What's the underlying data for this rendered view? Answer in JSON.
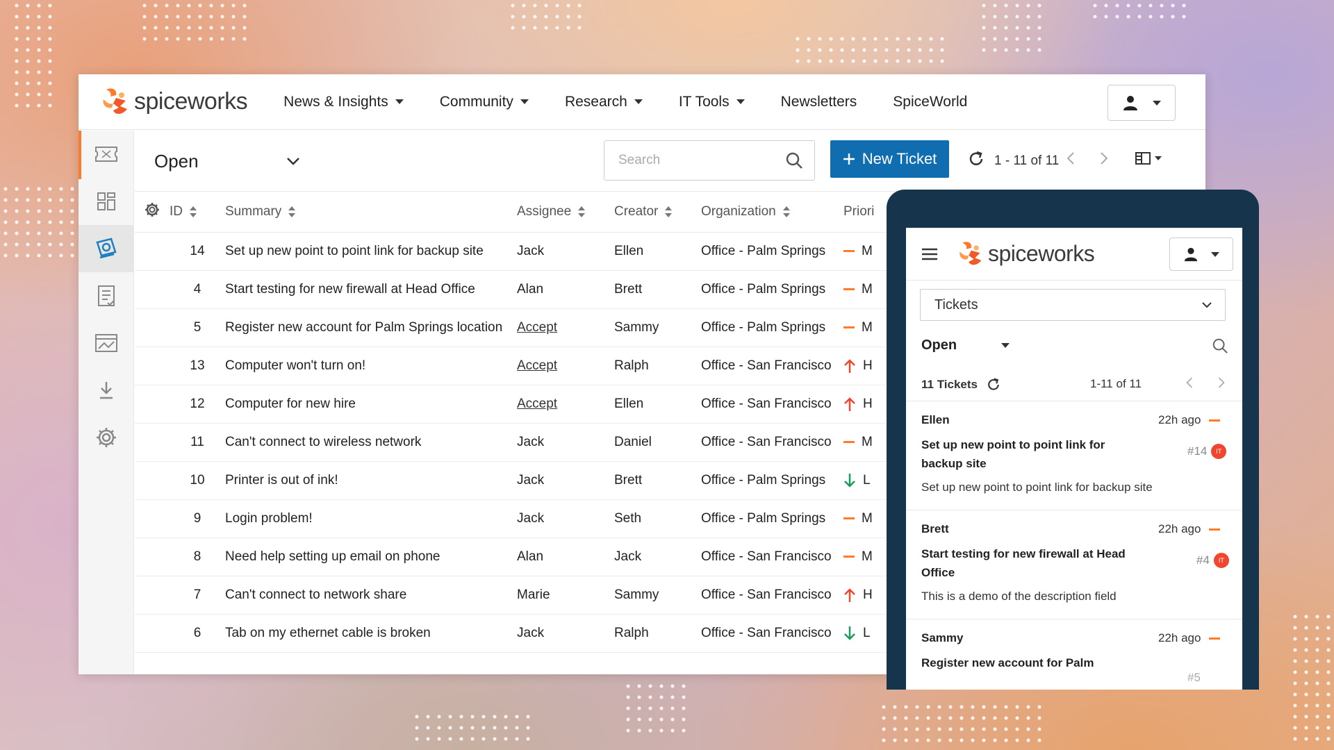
{
  "nav": {
    "logo_text": "spiceworks",
    "items": [
      "News & Insights",
      "Community",
      "Research",
      "IT Tools",
      "Newsletters",
      "SpiceWorld"
    ]
  },
  "toolbar": {
    "view": "Open",
    "search_placeholder": "Search",
    "new_ticket_label": "New Ticket",
    "pager": "1 - 11 of 11"
  },
  "table": {
    "headers": [
      "ID",
      "Summary",
      "Assignee",
      "Creator",
      "Organization",
      "Priori"
    ],
    "rows": [
      {
        "id": "14",
        "summary": "Set up new point to point link for backup site",
        "assignee": "Jack",
        "creator": "Ellen",
        "org": "Office - Palm Springs",
        "prio": "medium",
        "prio_letter": "M"
      },
      {
        "id": "4",
        "summary": "Start testing for new firewall at Head Office",
        "assignee": "Alan",
        "creator": "Brett",
        "org": "Office - Palm Springs",
        "prio": "medium",
        "prio_letter": "M"
      },
      {
        "id": "5",
        "summary": "Register new account for Palm Springs location",
        "assignee": "Accept",
        "creator": "Sammy",
        "org": "Office - Palm Springs",
        "prio": "medium",
        "prio_letter": "M"
      },
      {
        "id": "13",
        "summary": "Computer won't turn on!",
        "assignee": "Accept",
        "creator": "Ralph",
        "org": "Office - San Francisco",
        "prio": "high",
        "prio_letter": "H"
      },
      {
        "id": "12",
        "summary": "Computer for new hire",
        "assignee": "Accept",
        "creator": "Ellen",
        "org": "Office - San Francisco",
        "prio": "high",
        "prio_letter": "H"
      },
      {
        "id": "11",
        "summary": "Can't connect to wireless network",
        "assignee": "Jack",
        "creator": "Daniel",
        "org": "Office - San Francisco",
        "prio": "medium",
        "prio_letter": "M"
      },
      {
        "id": "10",
        "summary": "Printer is out of ink!",
        "assignee": "Jack",
        "creator": "Brett",
        "org": "Office - Palm Springs",
        "prio": "low",
        "prio_letter": "L"
      },
      {
        "id": "9",
        "summary": "Login problem!",
        "assignee": "Jack",
        "creator": "Seth",
        "org": "Office - Palm Springs",
        "prio": "medium",
        "prio_letter": "M"
      },
      {
        "id": "8",
        "summary": "Need help setting up email on phone",
        "assignee": "Alan",
        "creator": "Jack",
        "org": "Office - San Francisco",
        "prio": "medium",
        "prio_letter": "M"
      },
      {
        "id": "7",
        "summary": "Can't connect to network share",
        "assignee": "Marie",
        "creator": "Sammy",
        "org": "Office - San Francisco",
        "prio": "high",
        "prio_letter": "H"
      },
      {
        "id": "6",
        "summary": "Tab on my ethernet cable is broken",
        "assignee": "Jack",
        "creator": "Ralph",
        "org": "Office - San Francisco",
        "prio": "low",
        "prio_letter": "L"
      }
    ]
  },
  "mobile": {
    "logo_text": "spiceworks",
    "section_select": "Tickets",
    "view": "Open",
    "count": "11 Tickets",
    "pager": "1-11 of 11",
    "cards": [
      {
        "creator": "Ellen",
        "ago": "22h ago",
        "title": "Set up new point to point link for backup site",
        "num": "#14",
        "desc": "Set up new point to point link for backup site"
      },
      {
        "creator": "Brett",
        "ago": "22h ago",
        "title": "Start testing for new firewall at Head Office",
        "num": "#4",
        "desc": "This is a demo of the description field"
      },
      {
        "creator": "Sammy",
        "ago": "22h ago",
        "title": "Register new account for Palm",
        "num": "#5",
        "desc": ""
      }
    ]
  },
  "colors": {
    "accent": "#ff7b2b",
    "primary_button": "#0f6db0",
    "prio_high": "#f0462d",
    "prio_low": "#1a9b5c",
    "mobile_frame": "#16354d"
  },
  "icons": [
    "user-icon",
    "tickets-icon",
    "dashboard-icon",
    "help-desk-icon",
    "reports-icon",
    "inventory-icon",
    "download-icon",
    "settings-icon",
    "gear-icon",
    "search-icon",
    "refresh-icon",
    "chevron-left-icon",
    "chevron-right-icon",
    "columns-icon",
    "menu-icon"
  ]
}
